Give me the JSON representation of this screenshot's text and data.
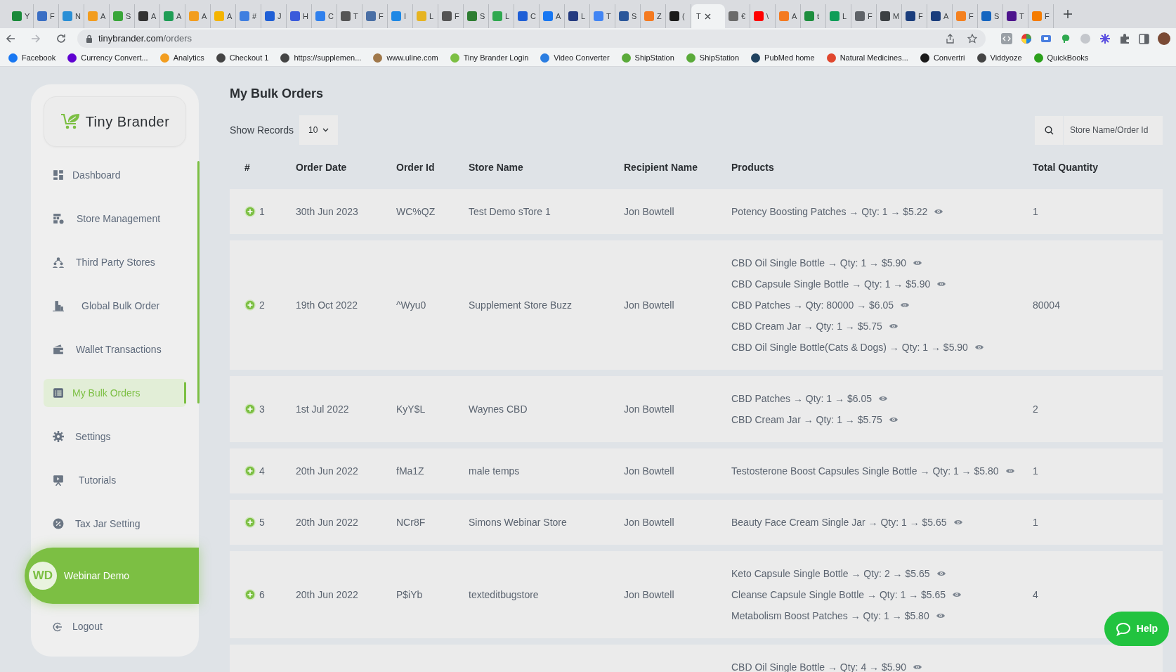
{
  "browser": {
    "tabs": [
      {
        "letter": "Y",
        "color": "#1a8a3a",
        "selected": false
      },
      {
        "letter": "F",
        "color": "#3b6fc4",
        "selected": false
      },
      {
        "letter": "N",
        "color": "#2a8fd6",
        "selected": false
      },
      {
        "letter": "A",
        "color": "#f29d1f",
        "selected": false
      },
      {
        "letter": "S",
        "color": "#3aa63a",
        "selected": false
      },
      {
        "letter": "A",
        "color": "#333333",
        "selected": false
      },
      {
        "letter": "A",
        "color": "#1f9d55",
        "selected": false
      },
      {
        "letter": "A",
        "color": "#f29d1f",
        "selected": false
      },
      {
        "letter": "A",
        "color": "#f4b400",
        "selected": false
      },
      {
        "letter": "#",
        "color": "#3f7fe0",
        "selected": false
      },
      {
        "letter": "J",
        "color": "#1f5fd6",
        "selected": false
      },
      {
        "letter": "H",
        "color": "#3b5bdb",
        "selected": false
      },
      {
        "letter": "C",
        "color": "#2f80ed",
        "selected": false
      },
      {
        "letter": "T",
        "color": "#555555",
        "selected": false
      },
      {
        "letter": "F",
        "color": "#4a6fa5",
        "selected": false
      },
      {
        "letter": "I",
        "color": "#1e88e5",
        "selected": false
      },
      {
        "letter": "L",
        "color": "#e6b422",
        "selected": false
      },
      {
        "letter": "F",
        "color": "#555555",
        "selected": false
      },
      {
        "letter": "S",
        "color": "#2e7d32",
        "selected": false
      },
      {
        "letter": "L",
        "color": "#2fa84f",
        "selected": false
      },
      {
        "letter": "C",
        "color": "#1f5fd6",
        "selected": false
      },
      {
        "letter": "A",
        "color": "#1877f2",
        "selected": false
      },
      {
        "letter": "L",
        "color": "#253b80",
        "selected": false
      },
      {
        "letter": "T",
        "color": "#4285f4",
        "selected": false
      },
      {
        "letter": "S",
        "color": "#2b579a",
        "selected": false
      },
      {
        "letter": "Z",
        "color": "#f47a20",
        "selected": false
      },
      {
        "letter": "(",
        "color": "#1a1a1a",
        "selected": false
      },
      {
        "letter": "T",
        "selected": true
      },
      {
        "letter": "€",
        "color": "#6b6b6b",
        "selected": false
      },
      {
        "letter": "\\",
        "color": "#ff0000",
        "selected": false
      },
      {
        "letter": "A",
        "color": "#f47a20",
        "selected": false
      },
      {
        "letter": "t",
        "color": "#1e8e3e",
        "selected": false
      },
      {
        "letter": "L",
        "color": "#0f9d58",
        "selected": false
      },
      {
        "letter": "F",
        "color": "#5f6368",
        "selected": false
      },
      {
        "letter": "M",
        "color": "#3c4043",
        "selected": false
      },
      {
        "letter": "F",
        "color": "#1a3d7c",
        "selected": false
      },
      {
        "letter": "A",
        "color": "#1a3d7c",
        "selected": false
      },
      {
        "letter": "F",
        "color": "#f48120",
        "selected": false
      },
      {
        "letter": "S",
        "color": "#1565c0",
        "selected": false
      },
      {
        "letter": "T",
        "color": "#4d148c",
        "selected": false
      },
      {
        "letter": "F",
        "color": "#f57c00",
        "selected": false
      }
    ],
    "url_host": "tinybrander.com",
    "url_path": "/orders",
    "bookmarks": [
      {
        "label": "Facebook",
        "color": "#1877f2"
      },
      {
        "label": "Currency Convert...",
        "color": "#5f01d1"
      },
      {
        "label": "Analytics",
        "color": "#f29d1f"
      },
      {
        "label": "Checkout 1",
        "color": "#444444"
      },
      {
        "label": "https://supplemen...",
        "color": "#444444"
      },
      {
        "label": "www.uline.com",
        "color": "#a0784a"
      },
      {
        "label": "Tiny Brander Login",
        "color": "#7cbf43"
      },
      {
        "label": "Video Converter",
        "color": "#2a7de1"
      },
      {
        "label": "ShipStation",
        "color": "#5aaa3a"
      },
      {
        "label": "ShipStation",
        "color": "#5aaa3a"
      },
      {
        "label": "PubMed home",
        "color": "#20425f"
      },
      {
        "label": "Natural Medicines...",
        "color": "#e0472e"
      },
      {
        "label": "Convertri",
        "color": "#1a1a1a"
      },
      {
        "label": "Viddyoze",
        "color": "#444444"
      },
      {
        "label": "QuickBooks",
        "color": "#2ca01c"
      }
    ]
  },
  "sidebar": {
    "brand": "Tiny Brander",
    "items": [
      {
        "label": "Dashboard",
        "kind": "dashboard",
        "selected": false
      },
      {
        "label": "Store Management",
        "kind": "store",
        "selected": false
      },
      {
        "label": "Third Party Stores",
        "kind": "people",
        "selected": false
      },
      {
        "label": "Global Bulk Order",
        "kind": "building",
        "selected": false
      },
      {
        "label": "Wallet Transactions",
        "kind": "wallet",
        "selected": false
      },
      {
        "label": "My Bulk Orders",
        "kind": "list",
        "selected": true
      },
      {
        "label": "Settings",
        "kind": "gear",
        "selected": false
      },
      {
        "label": "Tutorials",
        "kind": "easel",
        "selected": false
      },
      {
        "label": "Tax Jar Setting",
        "kind": "percent",
        "selected": false
      }
    ],
    "user": {
      "initials": "WD",
      "name": "Webinar Demo"
    },
    "logout": "Logout"
  },
  "main": {
    "title": "My Bulk Orders",
    "show_records_label": "Show Records",
    "show_records_value": "10",
    "search_placeholder": "Store Name/Order Id",
    "table": {
      "columns": [
        "#",
        "Order Date",
        "Order Id",
        "Store Name",
        "Recipient Name",
        "Products",
        "Total Quantity"
      ],
      "rows": [
        {
          "number": "1",
          "date": "30th Jun 2023",
          "order_id": "WC%QZ",
          "store": "Test Demo sTore 1",
          "recipient": "Jon Bowtell",
          "products": [
            "Potency Boosting Patches → Qty: 1 → $5.22"
          ],
          "total_quantity": "1"
        },
        {
          "number": "2",
          "date": "19th Oct 2022",
          "order_id": "^Wyu0",
          "store": "Supplement Store Buzz",
          "recipient": "Jon Bowtell",
          "products": [
            "CBD Oil Single Bottle → Qty: 1 → $5.90",
            "CBD Capsule Single Bottle → Qty: 1 → $5.90",
            "CBD Patches → Qty: 80000 → $6.05",
            "CBD Cream Jar → Qty: 1 → $5.75",
            "CBD Oil Single Bottle(Cats & Dogs) → Qty: 1 → $5.90"
          ],
          "total_quantity": "80004"
        },
        {
          "number": "3",
          "date": "1st Jul 2022",
          "order_id": "KyY$L",
          "store": "Waynes CBD",
          "recipient": "Jon Bowtell",
          "products": [
            "CBD Patches → Qty: 1 → $6.05",
            "CBD Cream Jar → Qty: 1 → $5.75"
          ],
          "total_quantity": "2"
        },
        {
          "number": "4",
          "date": "20th Jun 2022",
          "order_id": "fMa1Z",
          "store": "male temps",
          "recipient": "Jon Bowtell",
          "products": [
            "Testosterone Boost Capsules Single Bottle → Qty: 1 → $5.80"
          ],
          "total_quantity": "1"
        },
        {
          "number": "5",
          "date": "20th Jun 2022",
          "order_id": "NCr8F",
          "store": "Simons Webinar Store",
          "recipient": "Jon Bowtell",
          "products": [
            "Beauty Face Cream Single Jar → Qty: 1 → $5.65"
          ],
          "total_quantity": "1"
        },
        {
          "number": "6",
          "date": "20th Jun 2022",
          "order_id": "P$iYb",
          "store": "texteditbugstore",
          "recipient": "Jon Bowtell",
          "products": [
            "Keto Capsule Single Bottle → Qty: 2 → $5.65",
            "Cleanse Capsule Single Bottle → Qty: 1 → $5.65",
            "Metabolism Boost Patches → Qty: 1 → $5.80"
          ],
          "total_quantity": "4"
        },
        {
          "products": [
            "CBD Oil Single Bottle → Qty: 4 → $5.90"
          ]
        }
      ]
    }
  },
  "help_button": "Help"
}
